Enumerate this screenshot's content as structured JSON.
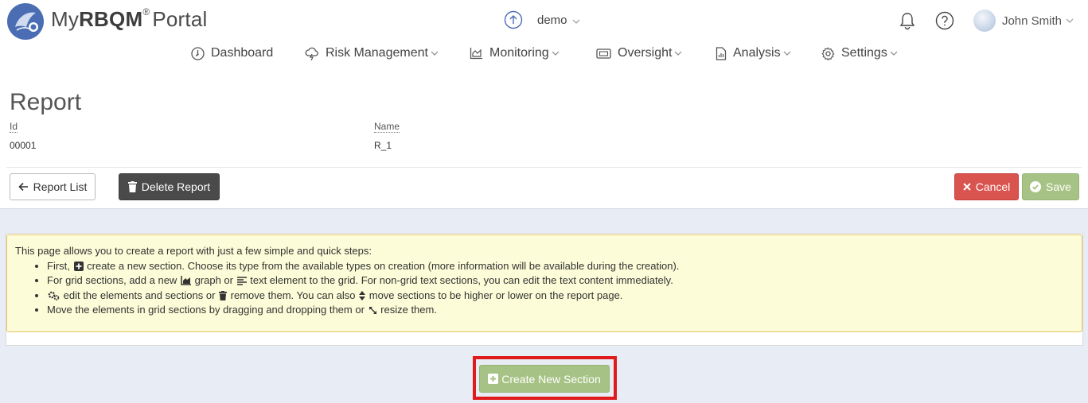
{
  "header": {
    "brand_prefix": "My",
    "brand_bold": "RBQM",
    "brand_reg": "®",
    "brand_suffix": "Portal",
    "env_label": "demo",
    "user_name": "John Smith"
  },
  "nav": {
    "items": [
      {
        "label": "Dashboard",
        "icon": "dashboard-icon",
        "dropdown": false
      },
      {
        "label": "Risk Management",
        "icon": "risk-cloud-icon",
        "dropdown": true
      },
      {
        "label": "Monitoring",
        "icon": "area-chart-icon",
        "dropdown": true
      },
      {
        "label": "Oversight",
        "icon": "oversight-ticket-icon",
        "dropdown": true
      },
      {
        "label": "Analysis",
        "icon": "analysis-document-icon",
        "dropdown": true
      },
      {
        "label": "Settings",
        "icon": "gear-icon",
        "dropdown": true
      }
    ]
  },
  "report": {
    "title": "Report",
    "id_label": "Id",
    "id_value": "00001",
    "name_label": "Name",
    "name_value": "R_1"
  },
  "actions": {
    "report_list": "Report List",
    "delete_report": "Delete Report",
    "cancel": "Cancel",
    "save": "Save"
  },
  "help": {
    "intro": "This page allows you to create a report with just a few simple and quick steps:",
    "s1a": "First,",
    "s1b": "create a new section. Choose its type from the available types on creation (more information will be available during the creation).",
    "s2a": "For grid sections, add a new",
    "s2b": "graph or",
    "s2c": "text element to the grid. For non-grid text sections, you can edit the text content immediately.",
    "s3a": "edit the elements and sections or",
    "s3b": "remove them. You can also",
    "s3c": "move sections to be higher or lower on the report page.",
    "s4a": "Move the elements in grid sections by dragging and dropping them or",
    "s4b": "resize them."
  },
  "create_section": "Create New Section",
  "colors": {
    "brand_blue": "#4a6db4",
    "danger": "#d9534f",
    "success": "#a6c284",
    "dark": "#4a4a4a",
    "help_bg": "#fcfcd8",
    "help_border": "#e8c267",
    "highlight": "#e01b1b"
  }
}
